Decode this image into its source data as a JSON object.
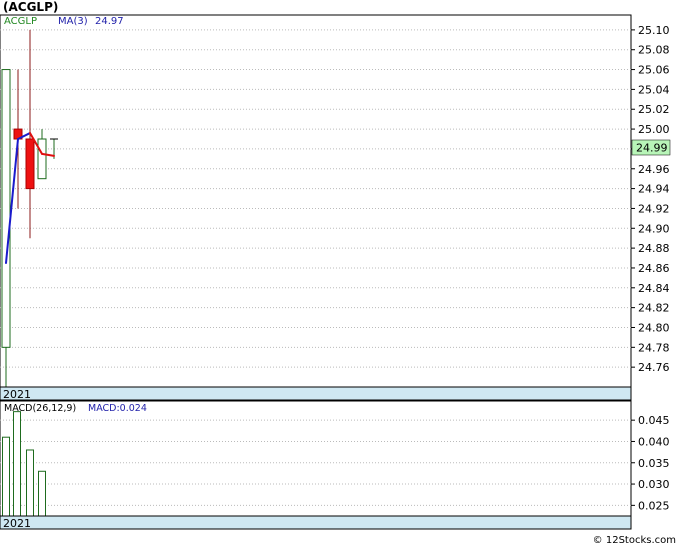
{
  "title": "(ACGLP)",
  "footer": "© 12Stocks.com",
  "colors": {
    "up": "#1e6b1e",
    "down": "#ee1111",
    "ma_rising": "#1a1acc",
    "ma_falling": "#e01010",
    "year_bar": "#cfe8f2",
    "price_badge": "#b8f5b8",
    "grid": "#bbbbbb",
    "macd_label": "#2222aa",
    "ma_label": "#2222aa",
    "ticker_label": "#228822"
  },
  "chart_data": [
    {
      "type": "candlestick",
      "ticker": "ACGLP",
      "legend": {
        "ticker_label": "ACGLP",
        "ma_label": "MA(3)",
        "ma_value": "24.97"
      },
      "last_price": "24.99",
      "year_label": "2021",
      "ylim": [
        24.74,
        25.115
      ],
      "yticks": [
        24.76,
        24.78,
        24.8,
        24.82,
        24.84,
        24.86,
        24.88,
        24.9,
        24.92,
        24.94,
        24.96,
        24.98,
        25.0,
        25.02,
        25.04,
        25.06,
        25.08,
        25.1
      ],
      "ytick_labels": [
        "24.76",
        "24.78",
        "24.80",
        "24.82",
        "24.84",
        "24.86",
        "24.88",
        "24.90",
        "24.92",
        "24.94",
        "24.96",
        "24.98",
        "25.00",
        "25.02",
        "25.04",
        "25.06",
        "25.08",
        "25.10"
      ],
      "candles": [
        {
          "open": 24.78,
          "high": 25.06,
          "low": 24.74,
          "close": 25.06
        },
        {
          "open": 25.0,
          "high": 25.06,
          "low": 24.92,
          "close": 24.99
        },
        {
          "open": 24.99,
          "high": 25.1,
          "low": 24.89,
          "close": 24.94
        },
        {
          "open": 24.95,
          "high": 25.0,
          "low": 24.95,
          "close": 24.99
        },
        {
          "open": 24.99,
          "high": 24.99,
          "low": 24.97,
          "close": 24.99
        }
      ],
      "ma": [
        24.865,
        24.99,
        24.996,
        24.975,
        24.973
      ]
    },
    {
      "type": "bar",
      "legend": {
        "indicator_label": "MACD(26,12,9)",
        "macd_label": "MACD:0.024"
      },
      "year_label": "2021",
      "ylim": [
        0.0225,
        0.0495
      ],
      "yticks": [
        0.025,
        0.03,
        0.035,
        0.04,
        0.045
      ],
      "ytick_labels": [
        "0.025",
        "0.030",
        "0.035",
        "0.040",
        "0.045"
      ],
      "values": [
        0.041,
        0.047,
        0.038,
        0.033
      ]
    }
  ]
}
